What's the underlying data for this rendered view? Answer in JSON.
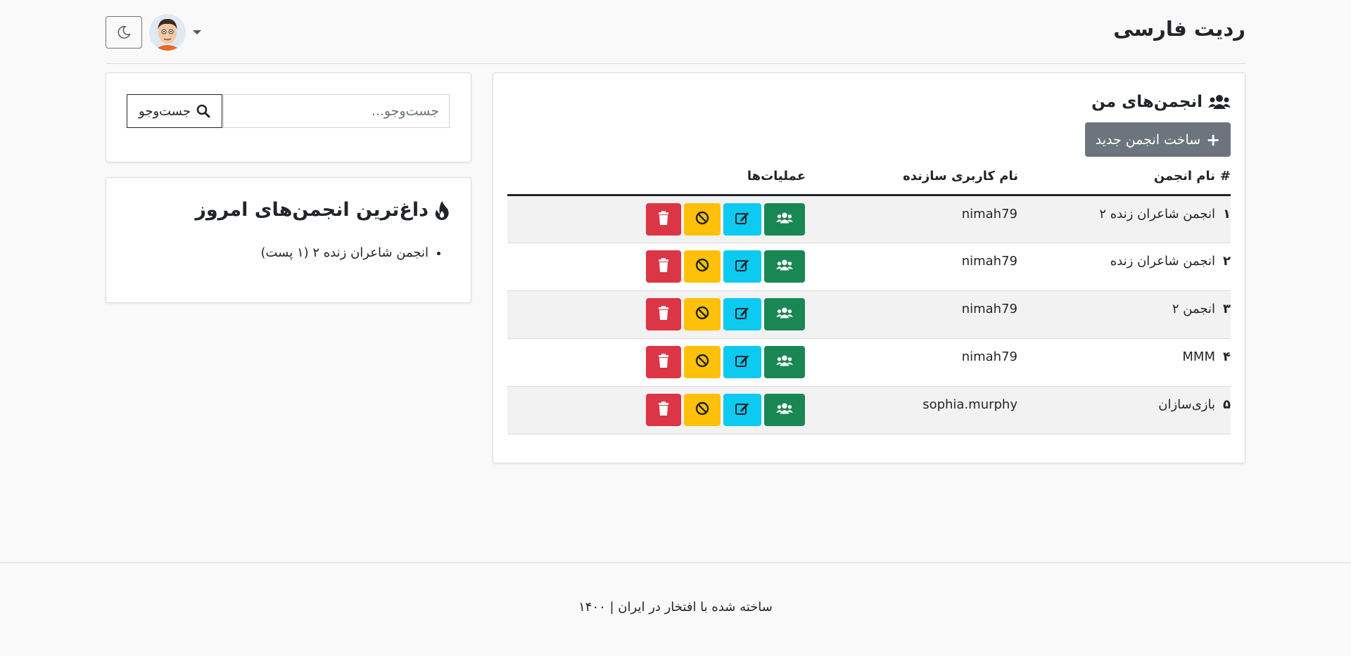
{
  "header": {
    "brand": "ردیت فارسی",
    "theme_icon": "moon-icon",
    "avatar_icon": "avatar-image"
  },
  "main": {
    "title": "انجمن‌های من",
    "title_icon": "users-icon",
    "new_button_label": "ساخت انجمن جدید",
    "columns": [
      "#",
      "نام انجمن",
      "نام کاربری سازنده",
      "عملیات‌ها"
    ],
    "rows": [
      {
        "num": "۱",
        "name": "انجمن شاعران زنده ۲",
        "creator": "nimah79"
      },
      {
        "num": "۲",
        "name": "انجمن شاعران زنده",
        "creator": "nimah79"
      },
      {
        "num": "۳",
        "name": "انجمن ۲",
        "creator": "nimah79"
      },
      {
        "num": "۴",
        "name": "MMM",
        "creator": "nimah79"
      },
      {
        "num": "۵",
        "name": "بازی‌سازان",
        "creator": "sophia.murphy"
      }
    ],
    "colors": {
      "members": "#198754",
      "edit": "#0dcaf0",
      "ban": "#ffc107",
      "delete": "#dc3545",
      "secondary": "#6c757d"
    }
  },
  "search": {
    "placeholder": "جست‌وجو...",
    "button_label": "جست‌وجو"
  },
  "hot": {
    "title": "داغ‌ترین انجمن‌های امروز",
    "icon": "fire-icon",
    "items": [
      "انجمن شاعران زنده ۲ (۱ پست)"
    ]
  },
  "footer": {
    "text": "ساخته شده با افتخار در ایران | ۱۴۰۰"
  }
}
